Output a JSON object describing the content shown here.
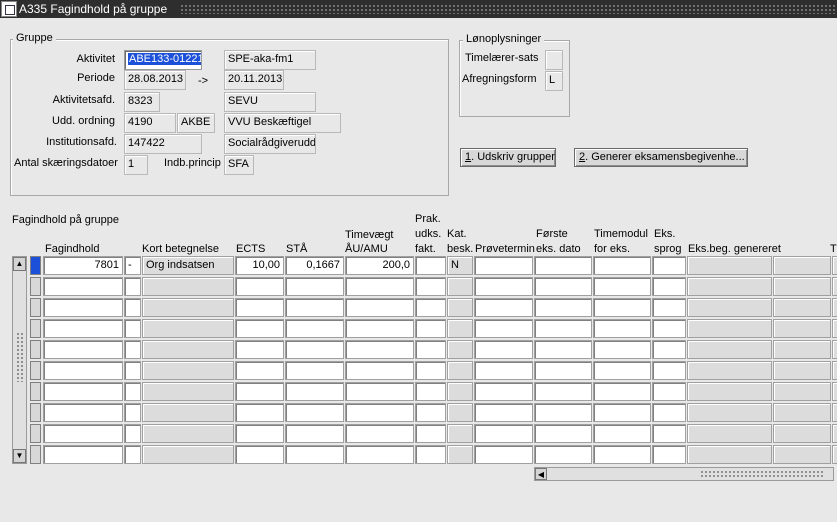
{
  "window": {
    "title": "A335 Fagindhold på gruppe"
  },
  "gruppe": {
    "title": "Gruppe",
    "aktivitet_label": "Aktivitet",
    "aktivitet": "ABE133-01221",
    "aktivitet_navn": "SPE-aka-fm1",
    "periode_label": "Periode",
    "periode_fra": "28.08.2013",
    "periode_arrow": "->",
    "periode_til": "20.11.2013",
    "aktivitetsafd_label": "Aktivitetsafd.",
    "aktivitetsafd": "8323",
    "aktivitetsafd_navn": "SEVU",
    "udd_label": "Udd. ordning",
    "udd_nr": "4190",
    "udd_kode": "AKBE",
    "udd_navn": "VVU Beskæftigel",
    "inst_label": "Institutionsafd.",
    "inst_nr": "147422",
    "inst_navn": "Socialrådgiverudd",
    "antal_label": "Antal skæringsdatoer",
    "antal": "1",
    "indb_label": "Indb.princip",
    "indb": "SFA"
  },
  "lon": {
    "title": "Lønoplysninger",
    "timelaerer_label": "Timelærer-sats",
    "timelaerer": "",
    "afregning_label": "Afregningsform",
    "afregning": "L"
  },
  "buttons": {
    "udskriv_key": "1",
    "udskriv": ". Udskriv grupper",
    "generer_key": "2",
    "generer": ". Generer eksamensbegivenhe..."
  },
  "table": {
    "title": "Fagindhold på gruppe",
    "headers": {
      "fagindhold": "Fagindhold",
      "kort": "Kort betegnelse",
      "ects": "ECTS",
      "sta": "STÅ",
      "timevaegt_1": "Timevægt",
      "timevaegt_2": "ÅU/AMU",
      "prak_1": "Prak.",
      "prak_2": "udks.",
      "prak_3": "fakt.",
      "kat_1": "Kat.",
      "kat_2": "besk.",
      "provetermin": "Prøvetermin",
      "forste_1": "Første",
      "forste_2": "eks. dato",
      "timemodul_1": "Timemodul",
      "timemodul_2": "for eks.",
      "eks_1": "Eks.",
      "eks_2": "sprog",
      "eksbeg": "Eks.beg. genereret",
      "last": "T"
    },
    "rows": [
      {
        "fagindhold": "7801",
        "dash": "-",
        "kort": "Org indsatsen",
        "ects": "10,00",
        "sta": "0,1667",
        "timevaegt": "200,0",
        "prak": "",
        "kat": "N",
        "provetermin": "",
        "forste": "",
        "timemodul": "",
        "eks": "",
        "eksbeg": ""
      }
    ]
  }
}
